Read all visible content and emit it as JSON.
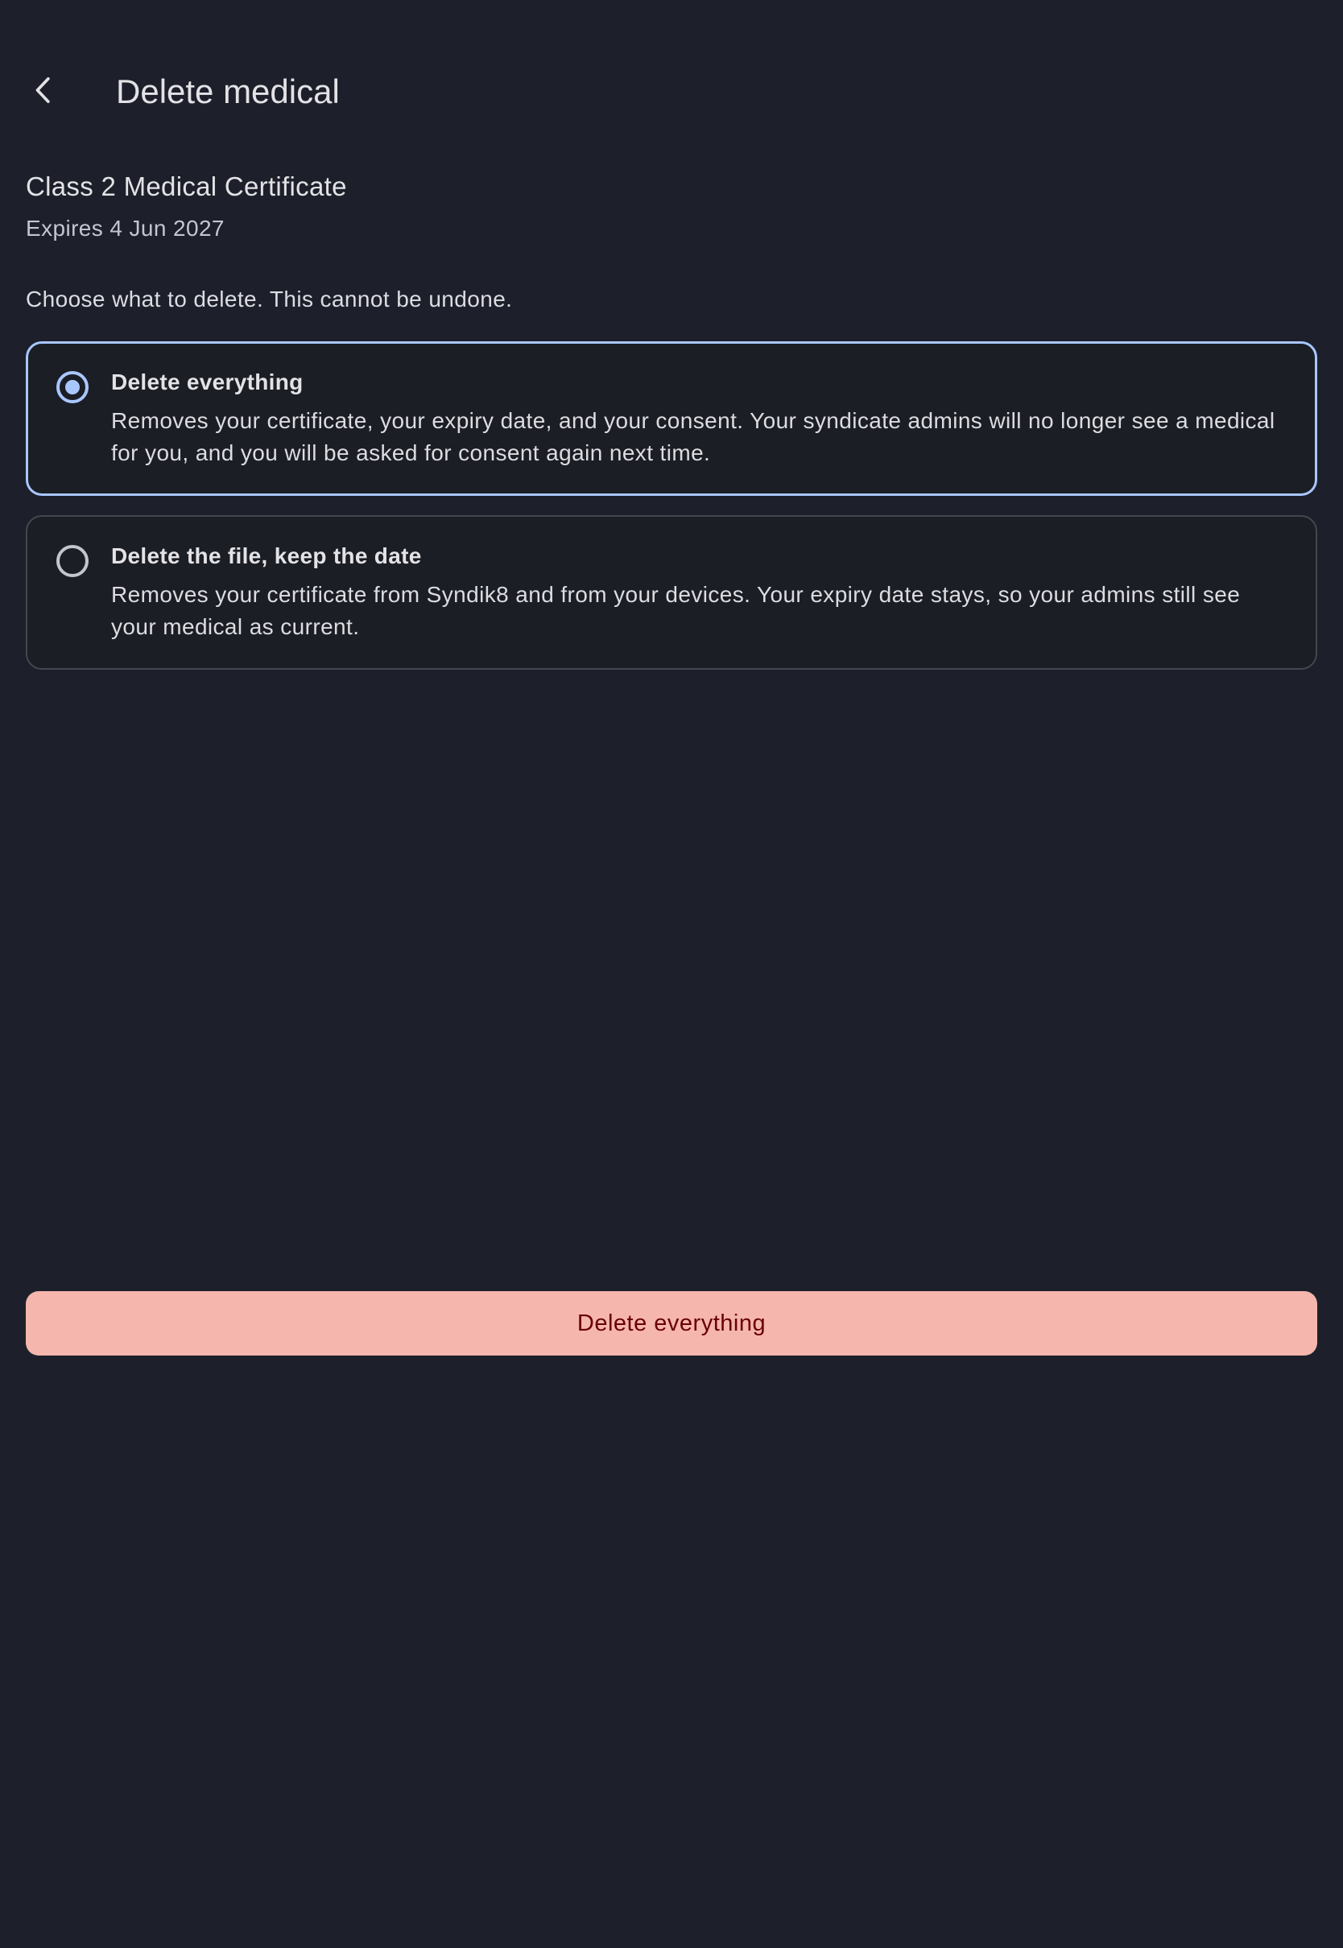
{
  "header": {
    "title": "Delete medical",
    "back_icon": "chevron-left-icon"
  },
  "medical": {
    "name": "Class 2 Medical Certificate",
    "expiry": "Expires 4 Jun 2027"
  },
  "instruction": "Choose what to delete. This cannot be undone.",
  "options": [
    {
      "title": "Delete everything",
      "description": "Removes your certificate, your expiry date, and your consent. Your syndicate admins will no longer see a medical for you, and you will be asked for consent again next time.",
      "selected": true
    },
    {
      "title": "Delete the file, keep the date",
      "description": "Removes your certificate from Syndik8 and from your devices. Your expiry date stays, so your admins still see your medical as current.",
      "selected": false
    }
  ],
  "action_button": {
    "label": "Delete everything"
  },
  "colors": {
    "background": "#1d202b",
    "accent": "#a9c7ff",
    "danger_button": "#f5b6ad",
    "danger_text": "#690005"
  }
}
